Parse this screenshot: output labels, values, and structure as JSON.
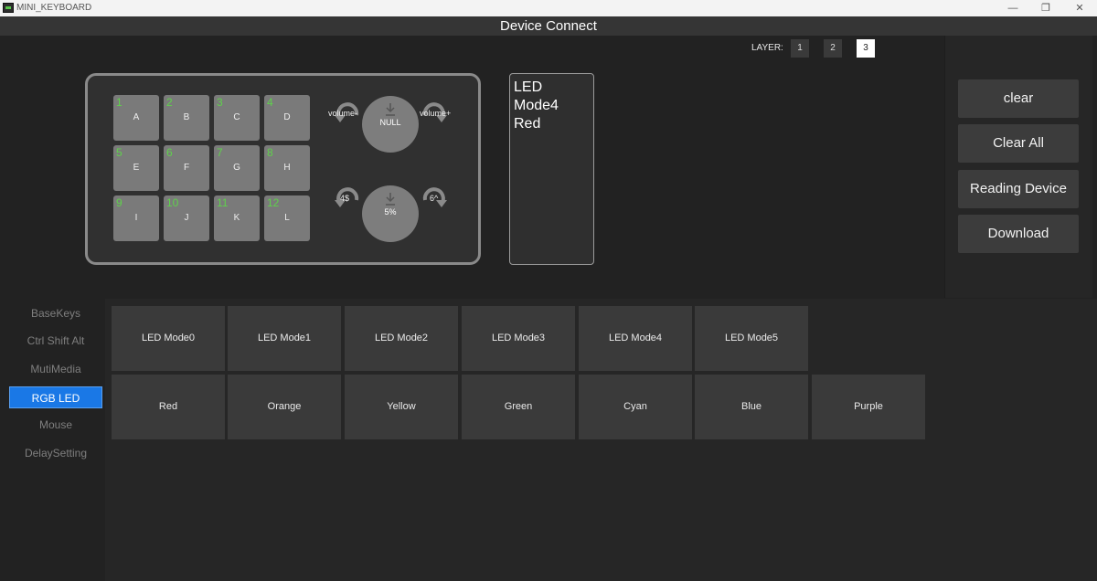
{
  "window": {
    "title": "MINI_KEYBOARD",
    "minimize": "—",
    "restore": "❐",
    "close": "✕"
  },
  "header": {
    "title": "Device Connect"
  },
  "layers": {
    "label": "LAYER:",
    "items": [
      "1",
      "2",
      "3"
    ],
    "active": "3"
  },
  "keyboard": {
    "keys": [
      {
        "num": "1",
        "label": "A"
      },
      {
        "num": "2",
        "label": "B"
      },
      {
        "num": "3",
        "label": "C"
      },
      {
        "num": "4",
        "label": "D"
      },
      {
        "num": "5",
        "label": "E"
      },
      {
        "num": "6",
        "label": "F"
      },
      {
        "num": "7",
        "label": "G"
      },
      {
        "num": "8",
        "label": "H"
      },
      {
        "num": "9",
        "label": "I"
      },
      {
        "num": "10",
        "label": "J"
      },
      {
        "num": "11",
        "label": "K"
      },
      {
        "num": "12",
        "label": "L"
      }
    ],
    "knob1": {
      "left": "volume-",
      "center": "NULL",
      "right": "volume+"
    },
    "knob2": {
      "left": "4$",
      "center": "5%",
      "right": "6^"
    }
  },
  "preview": {
    "lines": [
      "LED",
      "Mode4",
      "Red"
    ]
  },
  "actions": {
    "clear": "clear",
    "clear_all": "Clear All",
    "reading_device": "Reading Device",
    "download": "Download"
  },
  "sidebar": {
    "items": [
      "BaseKeys",
      "Ctrl Shift Alt",
      "MutiMedia",
      "RGB LED",
      "Mouse",
      "DelaySetting"
    ],
    "active": "RGB LED"
  },
  "led": {
    "modes": [
      "LED Mode0",
      "LED Mode1",
      "LED Mode2",
      "LED Mode3",
      "LED Mode4",
      "LED Mode5"
    ],
    "colors": [
      "Red",
      "Orange",
      "Yellow",
      "Green",
      "Cyan",
      "Blue",
      "Purple"
    ]
  },
  "colors": {
    "accent": "#1a78e6",
    "key_number": "#5fd14b"
  }
}
